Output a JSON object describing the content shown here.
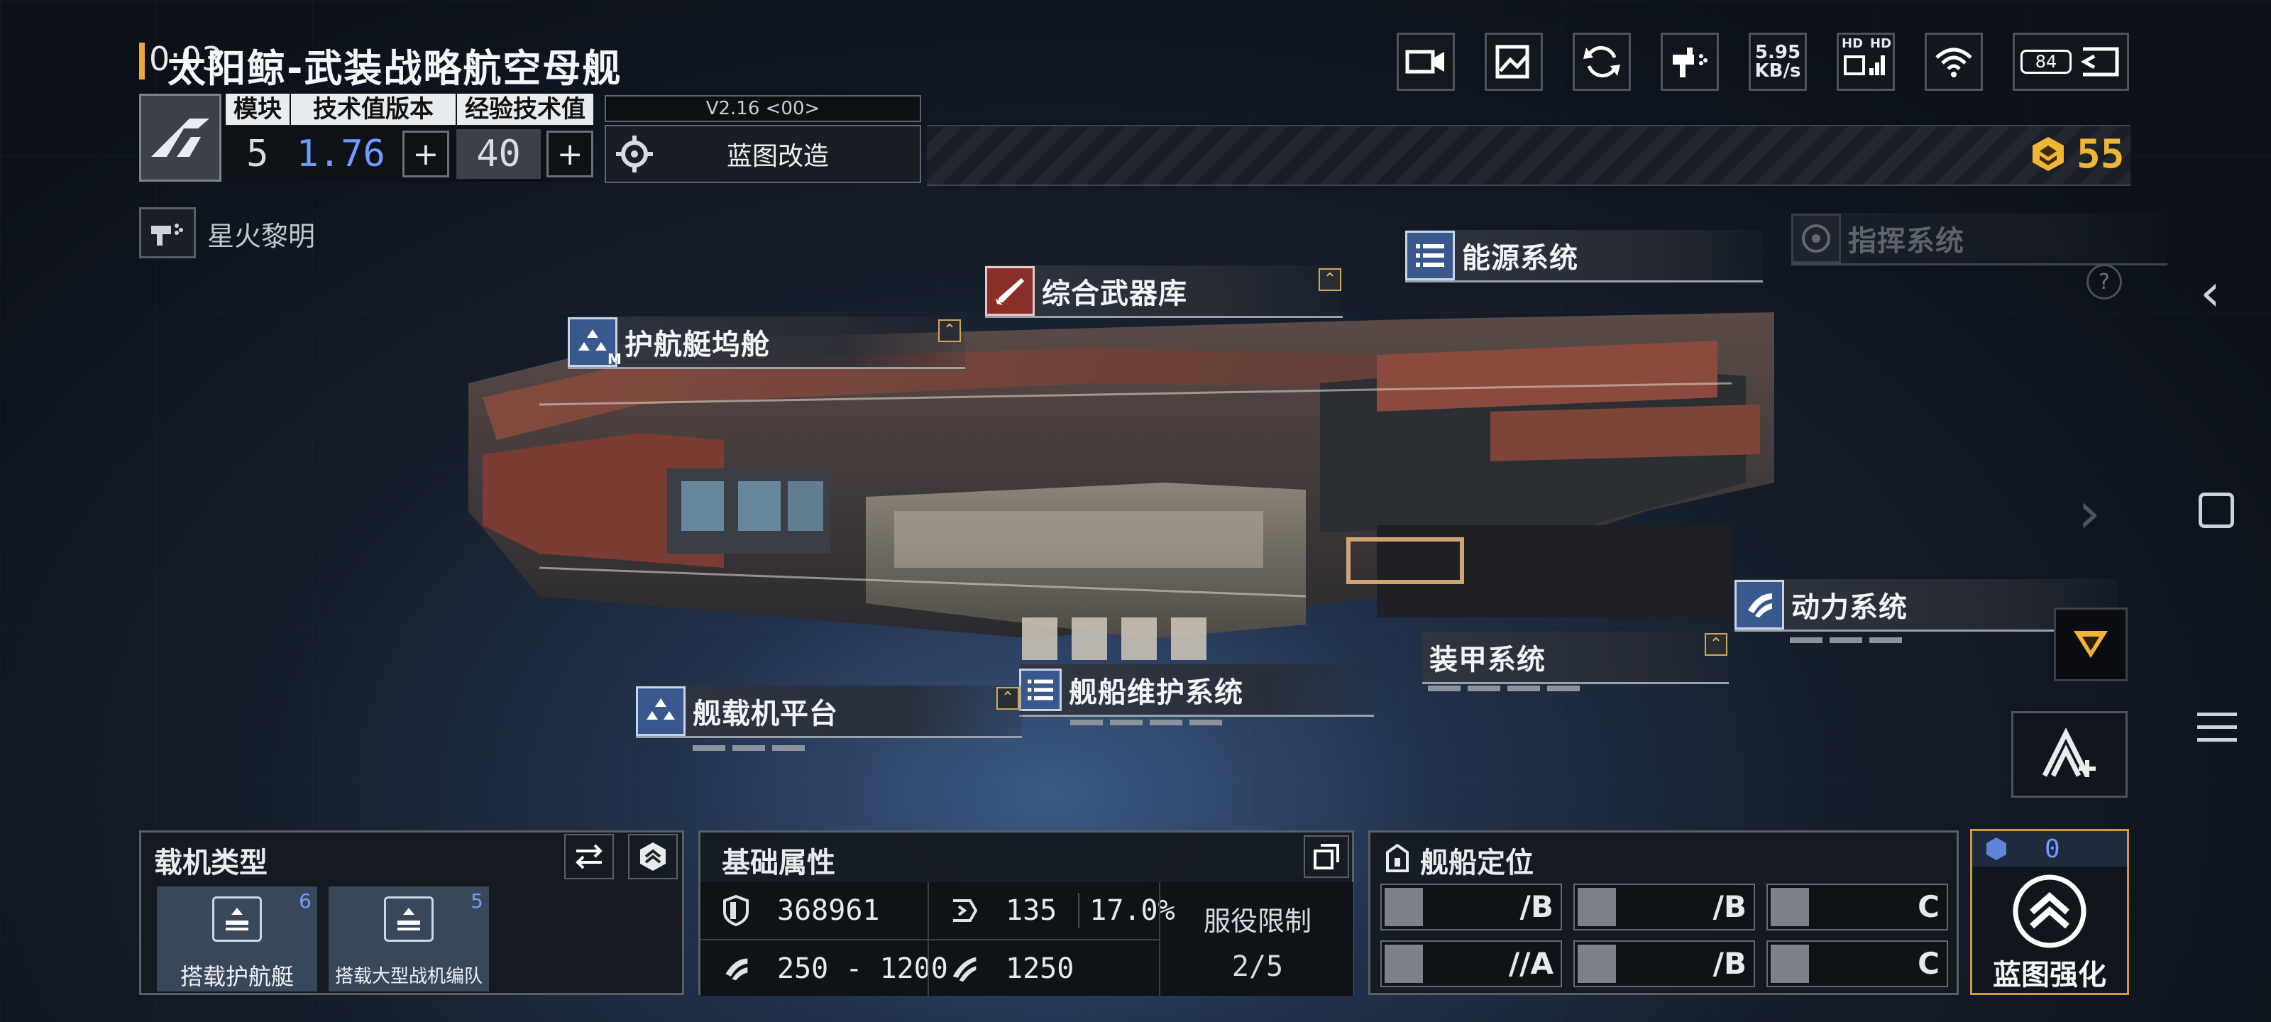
{
  "status_bar": {
    "time": "0:03",
    "net_speed_value": "5.95",
    "net_speed_unit": "KB/s",
    "hd1": "HD",
    "hd2": "HD",
    "battery": "84"
  },
  "header": {
    "ship_name": "太阳鲸-武装战略航空母舰",
    "col_module": "模块",
    "col_tech_version": "技术值版本",
    "col_exp_tech": "经验技术值",
    "module_value": "5",
    "tech_version_value": "1.76",
    "exp_tech_value": "40",
    "version_tag": "V2.16 <00>",
    "blueprint_mod_label": "蓝图改造",
    "currency_value": "55"
  },
  "skin": {
    "label": "星火黎明"
  },
  "modules": [
    {
      "id": "escort-dock",
      "label": "护航艇坞舱",
      "badge": "M"
    },
    {
      "id": "weapon-arsenal",
      "label": "综合武器库"
    },
    {
      "id": "energy-system",
      "label": "能源系统"
    },
    {
      "id": "command-system",
      "label": "指挥系统"
    },
    {
      "id": "power-system",
      "label": "动力系统"
    },
    {
      "id": "armor-system",
      "label": "装甲系统"
    },
    {
      "id": "maintenance-system",
      "label": "舰船维护系统"
    },
    {
      "id": "carrier-platform",
      "label": "舰载机平台"
    }
  ],
  "carrier_panel": {
    "title": "载机类型",
    "items": [
      {
        "label": "搭载护航艇",
        "count": "6"
      },
      {
        "label": "搭载大型战机编队",
        "count": "5"
      }
    ]
  },
  "base_attrs": {
    "title": "基础属性",
    "hp": "368961",
    "armor": "135",
    "armor_pct": "17.0%",
    "speed_range": "250 - 1200",
    "warp": "1250",
    "service_limit_label": "服役限制",
    "service_limit_value": "2/5"
  },
  "ship_position": {
    "title": "舰船定位",
    "ratings": [
      {
        "icon": "anti-fighter",
        "grade": "/B"
      },
      {
        "icon": "anti-corvette",
        "grade": "/B"
      },
      {
        "icon": "anti-frigate",
        "grade": "C"
      },
      {
        "icon": "anti-capital",
        "grade": "//A"
      },
      {
        "icon": "defense",
        "grade": "/B"
      },
      {
        "icon": "support",
        "grade": "C"
      }
    ]
  },
  "enhance": {
    "count": "0",
    "label": "蓝图强化"
  },
  "colors": {
    "accent_blue": "#6f9dff",
    "gold": "#f0b534",
    "panel_bg": "#161a20"
  }
}
